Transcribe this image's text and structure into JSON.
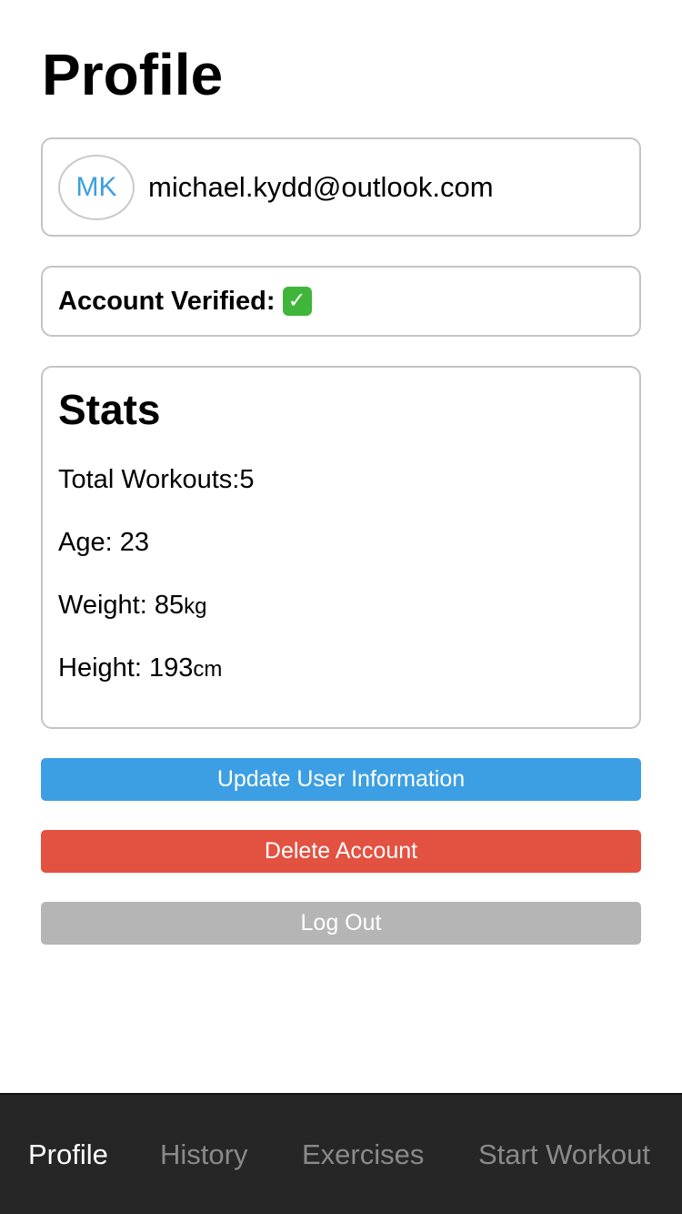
{
  "header": {
    "title": "Profile"
  },
  "user": {
    "initials": "MK",
    "email": "michael.kydd@outlook.com"
  },
  "verification": {
    "label": "Account Verified:",
    "status_icon": "check-mark-button-emoji",
    "status_glyph": "✓",
    "verified": true
  },
  "stats": {
    "heading": "Stats",
    "total_workouts_label": "Total Workouts:",
    "total_workouts_value": "5",
    "age_label": "Age:",
    "age_value": "23",
    "weight_label": "Weight:",
    "weight_value": "85",
    "weight_unit": "kg",
    "height_label": "Height:",
    "height_value": "193",
    "height_unit": "cm"
  },
  "actions": {
    "update_label": "Update User Information",
    "delete_label": "Delete Account",
    "logout_label": "Log Out"
  },
  "colors": {
    "update": "#3d9fe3",
    "delete": "#e35141",
    "logout": "#b5b5b5",
    "tabbar": "#262626",
    "tab_active": "#ffffff",
    "tab_inactive": "#8a8a8a"
  },
  "tabs": [
    {
      "label": "Profile",
      "active": true
    },
    {
      "label": "History",
      "active": false
    },
    {
      "label": "Exercises",
      "active": false
    },
    {
      "label": "Start Workout",
      "active": false
    }
  ]
}
